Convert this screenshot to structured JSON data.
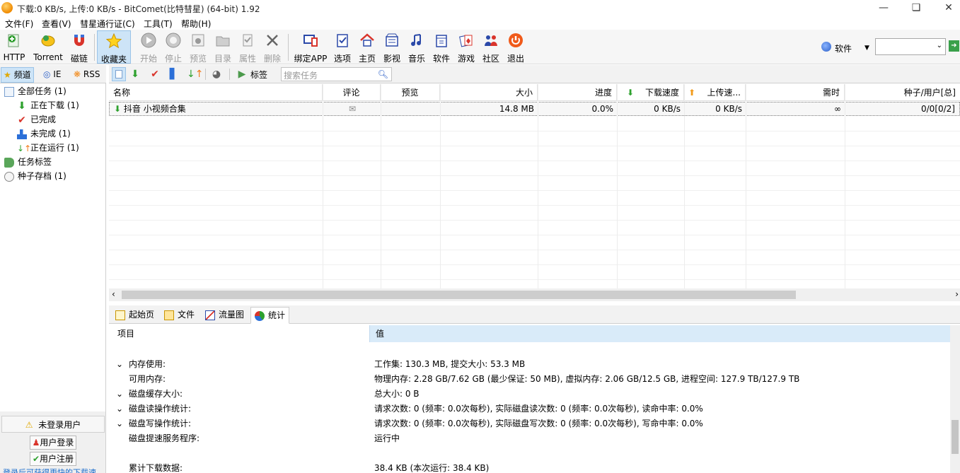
{
  "window": {
    "title": "下载:0 KB/s, 上传:0 KB/s - BitComet(比特彗星) (64-bit) 1.92"
  },
  "menu": [
    "文件(F)",
    "查看(V)",
    "彗星通行证(C)",
    "工具(T)",
    "帮助(H)"
  ],
  "toolbar": {
    "items": [
      "HTTP",
      "Torrent",
      "磁链",
      "收藏夹",
      "开始",
      "停止",
      "预览",
      "目录",
      "属性",
      "删除",
      "绑定APP",
      "选项",
      "主页",
      "影视",
      "音乐",
      "软件",
      "游戏",
      "社区",
      "退出"
    ],
    "software_label": "软件",
    "combo_value": ""
  },
  "left_tabs": [
    "频道",
    "IE",
    "RSS"
  ],
  "tree": {
    "all": "全部任务 (1)",
    "downloading": "正在下载 (1)",
    "completed": "已完成",
    "incomplete": "未完成 (1)",
    "running": "正在运行 (1)",
    "tags": "任务标签",
    "archive": "种子存档 (1)"
  },
  "login": {
    "status": "未登录用户",
    "login_btn": "用户登录",
    "register_btn": "用户注册",
    "promo": "登录后可获得更快的下载速"
  },
  "task_toolbar": {
    "tag_label": "标签",
    "search_placeholder": "搜索任务"
  },
  "columns": [
    "名称",
    "评论",
    "预览",
    "大小",
    "进度",
    "下载速度",
    "上传速...",
    "需时",
    "种子/用户[总]"
  ],
  "tasks": [
    {
      "name": "抖音 小视频合集",
      "size": "14.8 MB",
      "progress": "0.0%",
      "down": "0 KB/s",
      "up": "0 KB/s",
      "eta": "∞",
      "peers": "0/0[0/2]"
    }
  ],
  "bottom_tabs": [
    "起始页",
    "文件",
    "流量图",
    "统计"
  ],
  "stats": {
    "headers": [
      "项目",
      "值"
    ],
    "rows": [
      {
        "key": "内存使用:",
        "value": "工作集: 130.3 MB, 提交大小: 53.3 MB",
        "expand": true
      },
      {
        "key": "可用内存:",
        "value": "物理内存: 2.28 GB/7.62 GB (最少保证: 50 MB), 虚拟内存: 2.06 GB/12.5 GB, 进程空间: 127.9 TB/127.9 TB",
        "expand": false
      },
      {
        "key": "磁盘缓存大小:",
        "value": "总大小: 0 B",
        "expand": true
      },
      {
        "key": "磁盘读操作统计:",
        "value": "请求次数: 0 (频率: 0.0次每秒), 实际磁盘读次数: 0 (频率: 0.0次每秒), 读命中率: 0.0%",
        "expand": true
      },
      {
        "key": "磁盘写操作统计:",
        "value": "请求次数: 0 (频率: 0.0次每秒), 实际磁盘写次数: 0 (频率: 0.0次每秒), 写命中率: 0.0%",
        "expand": true
      },
      {
        "key": "磁盘提速服务程序:",
        "value": "运行中",
        "expand": false
      },
      {
        "key": "累计下载数据:",
        "value": "38.4 KB (本次运行: 38.4 KB)",
        "expand": false
      }
    ]
  }
}
